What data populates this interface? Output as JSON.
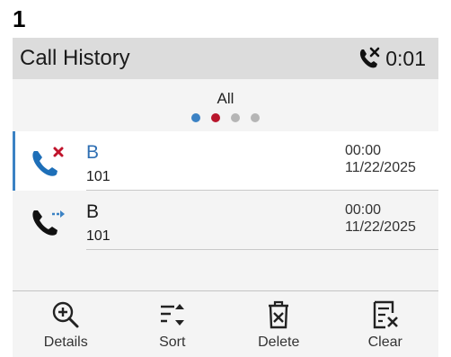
{
  "step": "1",
  "header": {
    "title": "Call History",
    "timer": "0:01",
    "status_icon": "missed-call-icon"
  },
  "filter": {
    "label": "All"
  },
  "page_dots": [
    {
      "color": "#3b82c4",
      "active": true
    },
    {
      "color": "#b8162c",
      "active": false
    },
    {
      "color": "#b5b5b5",
      "active": false
    },
    {
      "color": "#b5b5b5",
      "active": false
    }
  ],
  "calls": [
    {
      "type": "missed",
      "icon": "missed-call-icon",
      "name": "B",
      "number": "101",
      "duration": "00:00",
      "date": "11/22/2025",
      "selected": true
    },
    {
      "type": "outgoing",
      "icon": "forwarded-call-icon",
      "name": "B",
      "number": "101",
      "duration": "00:00",
      "date": "11/22/2025",
      "selected": false
    }
  ],
  "softkeys": [
    {
      "label": "Details",
      "icon": "zoom-in-icon"
    },
    {
      "label": "Sort",
      "icon": "sort-icon"
    },
    {
      "label": "Delete",
      "icon": "trash-icon"
    },
    {
      "label": "Clear",
      "icon": "clear-list-icon"
    }
  ],
  "colors": {
    "accent": "#3b82c4",
    "missed": "#c0142c",
    "header_bg": "#dcdcdc"
  }
}
